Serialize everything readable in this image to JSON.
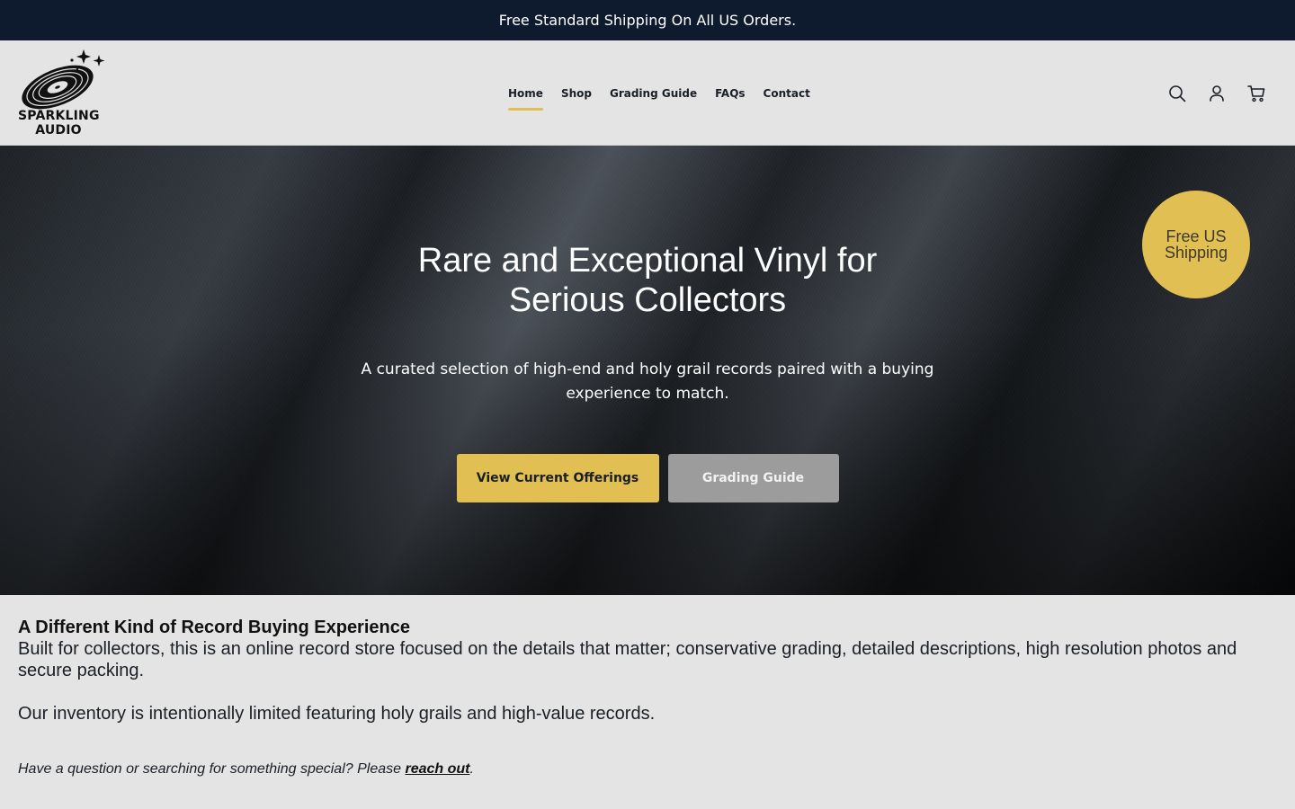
{
  "announcement": {
    "text": "Free Standard Shipping On All US Orders."
  },
  "brand": {
    "line1": "SPARKLING",
    "line2": "AUDIO"
  },
  "nav": {
    "items": [
      {
        "label": "Home",
        "active": true
      },
      {
        "label": "Shop",
        "active": false
      },
      {
        "label": "Grading Guide",
        "active": false
      },
      {
        "label": "FAQs",
        "active": false
      },
      {
        "label": "Contact",
        "active": false
      }
    ]
  },
  "header_icons": [
    "search-icon",
    "account-icon",
    "cart-icon"
  ],
  "hero": {
    "title": "Rare and Exceptional Vinyl for Serious Collectors",
    "subtitle": "A curated selection of high-end and holy grail records paired with a buying experience to match.",
    "primary_button": "View Current Offerings",
    "secondary_button": "Grading Guide",
    "badge": {
      "line1": "Free US",
      "line2": "Shipping"
    }
  },
  "about": {
    "heading": "A Different Kind of Record Buying Experience",
    "paragraph1": "Built for collectors, this is an online record store focused on the details that matter; conservative grading, detailed descriptions, high resolution photos and secure packing.",
    "paragraph2": "Our inventory is intentionally limited featuring holy grails and high-value records.",
    "note_prefix": "Have a question or searching for something special? Please ",
    "note_link": "reach out",
    "note_suffix": "."
  },
  "colors": {
    "accent": "#e2bf52",
    "announcement_bg": "#0e1a2d",
    "page_bg": "#e4e4e4",
    "secondary_button": "#9c9c9c"
  }
}
